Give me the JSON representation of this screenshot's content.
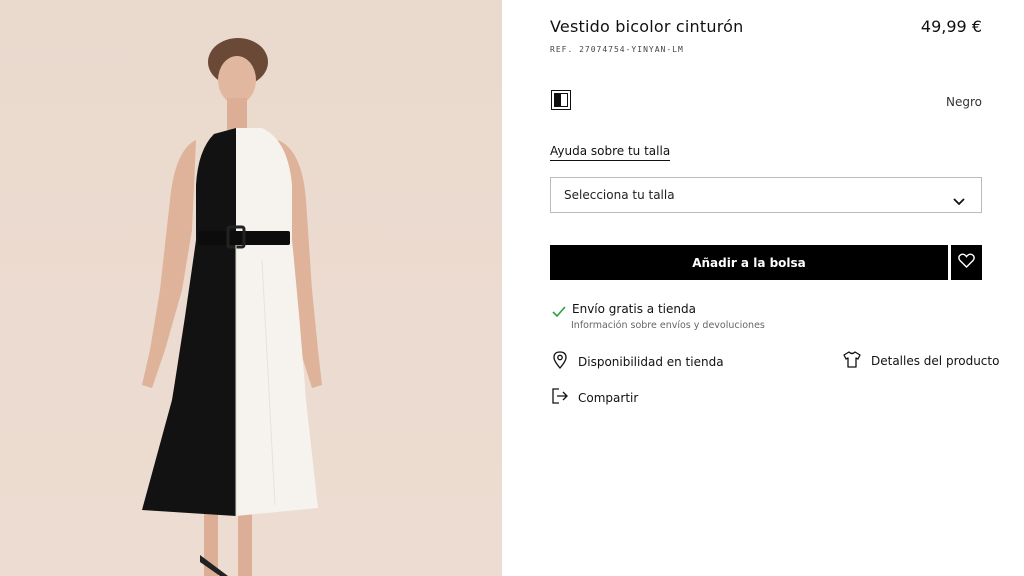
{
  "product": {
    "title": "Vestido bicolor cinturón",
    "price": "49,99 €",
    "reference": "REF. 27074754-YINYAN-LM",
    "image_alt": "Vestido bicolor negro y blanco con cinturón"
  },
  "color": {
    "selected_name": "Negro",
    "swatch_colors": [
      "#111111",
      "#ffffff"
    ]
  },
  "size": {
    "help_link": "Ayuda sobre tu talla",
    "select_placeholder": "Selecciona tu talla",
    "chevron_icon": "chevron-down-icon"
  },
  "actions": {
    "add_to_bag": "Añadir a la bolsa",
    "favorite_icon": "heart-icon"
  },
  "shipping": {
    "icon": "check-icon",
    "title": "Envío gratis a tienda",
    "info_link": "Información sobre envíos y devoluciones"
  },
  "links": {
    "store_availability": "Disponibilidad en tienda",
    "store_icon": "location-pin-icon",
    "product_details": "Detalles del producto",
    "details_icon": "tshirt-icon",
    "share": "Compartir",
    "share_icon": "share-icon"
  },
  "colors": {
    "background_photo": "#ebdace",
    "button_bg": "#000000",
    "check_green": "#2f9e44"
  }
}
